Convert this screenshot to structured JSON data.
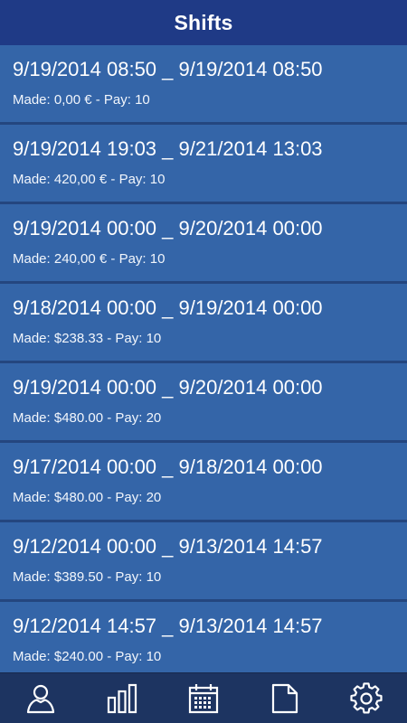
{
  "header": {
    "title": "Shifts"
  },
  "shifts": [
    {
      "range": "9/19/2014 08:50 _ 9/19/2014 08:50",
      "detail": "Made: 0,00 € - Pay: 10"
    },
    {
      "range": "9/19/2014 19:03 _ 9/21/2014 13:03",
      "detail": "Made: 420,00 € - Pay: 10"
    },
    {
      "range": "9/19/2014 00:00 _ 9/20/2014 00:00",
      "detail": "Made: 240,00 € - Pay: 10"
    },
    {
      "range": "9/18/2014 00:00 _ 9/19/2014 00:00",
      "detail": "Made: $238.33 - Pay: 10"
    },
    {
      "range": "9/19/2014 00:00 _ 9/20/2014 00:00",
      "detail": "Made: $480.00 - Pay: 20"
    },
    {
      "range": "9/17/2014 00:00 _ 9/18/2014 00:00",
      "detail": "Made: $480.00 - Pay: 20"
    },
    {
      "range": "9/12/2014 00:00 _ 9/13/2014 14:57",
      "detail": "Made: $389.50 - Pay: 10"
    },
    {
      "range": "9/12/2014 14:57 _ 9/13/2014 14:57",
      "detail": "Made: $240.00 - Pay: 10"
    }
  ],
  "tabbar": {
    "icons": [
      "user-icon",
      "bar-chart-icon",
      "calendar-icon",
      "document-icon",
      "gear-icon"
    ]
  },
  "colors": {
    "header": "#1f3a86",
    "row": "#3465a8",
    "tabbar": "#1d3461",
    "text": "#ffffff"
  }
}
